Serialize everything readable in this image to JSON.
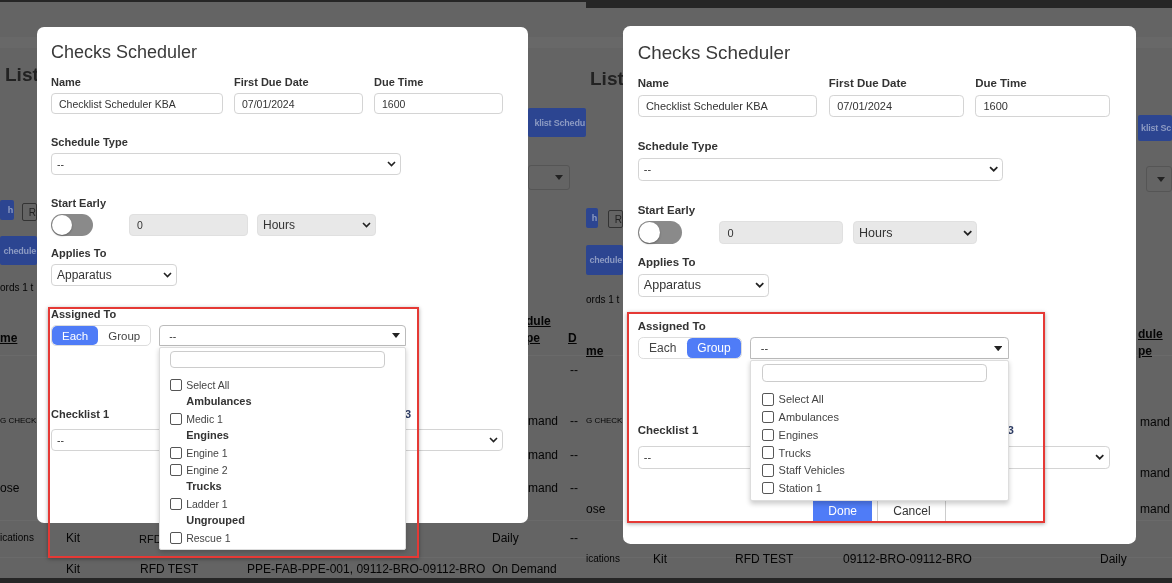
{
  "panels": [
    {
      "backdrop": [
        {
          "kind": "title",
          "text": "List"
        },
        {
          "kind": "button",
          "text": "klist Schedu"
        },
        {
          "kind": "select"
        },
        {
          "kind": "button",
          "text": "h"
        },
        {
          "kind": "outline_button",
          "text": "R"
        },
        {
          "kind": "tab",
          "text": "chedule"
        },
        {
          "kind": "info",
          "text": "ords 1 t"
        },
        {
          "kind": "header",
          "text": "me"
        },
        {
          "kind": "header",
          "text": "dule pe"
        },
        {
          "kind": "header",
          "text": "D"
        },
        {
          "kind": "cell",
          "text": "--"
        },
        {
          "kind": "cell",
          "text": "G CHECK"
        },
        {
          "kind": "cell",
          "text": "mand"
        },
        {
          "kind": "cell",
          "text": "--"
        },
        {
          "kind": "cell",
          "text": "mand"
        },
        {
          "kind": "cell",
          "text": "--"
        },
        {
          "kind": "cell",
          "text": "ose"
        },
        {
          "kind": "cell",
          "text": "mand"
        },
        {
          "kind": "cell",
          "text": "--"
        },
        {
          "kind": "cell",
          "text": "ications"
        },
        {
          "kind": "cell",
          "text": "Kit"
        },
        {
          "kind": "cell",
          "text": "RFD"
        },
        {
          "kind": "cell",
          "text": "Daily"
        },
        {
          "kind": "cell",
          "text": "--"
        },
        {
          "kind": "cell",
          "text": "Kit"
        },
        {
          "kind": "cell",
          "text": "RFD TEST"
        },
        {
          "kind": "cell",
          "text": "PPE-FAB-PPE-001, 09112-BRO-09112-BRO"
        },
        {
          "kind": "cell",
          "text": "On Demand"
        }
      ],
      "highlight_frame": true,
      "dialog": {
        "title": "Checks Scheduler",
        "top_fields": [
          {
            "label": "Name",
            "value": "Checklist Scheduler KBA"
          },
          {
            "label": "First Due Date",
            "value": "07/01/2024"
          },
          {
            "label": "Due Time",
            "value": "1600"
          }
        ],
        "schedule_type": {
          "label": "Schedule Type",
          "value": "--"
        },
        "start_early": {
          "label": "Start Early",
          "on": false,
          "disabled": true,
          "amount": "0",
          "unit": "Hours"
        },
        "applies_to": {
          "label": "Applies To",
          "value": "Apparatus"
        },
        "assigned_to": {
          "label": "Assigned To",
          "modes": [
            {
              "label": "Each",
              "selected": true
            },
            {
              "label": "Group",
              "selected": false
            }
          ],
          "value": "--",
          "expanded": true,
          "options": [
            {
              "kind": "option",
              "label": "Select All",
              "checked": false
            },
            {
              "kind": "group",
              "label": "Ambulances"
            },
            {
              "kind": "option",
              "label": "Medic 1",
              "checked": false
            },
            {
              "kind": "group",
              "label": "Engines"
            },
            {
              "kind": "option",
              "label": "Engine 1",
              "checked": false
            },
            {
              "kind": "option",
              "label": "Engine 2",
              "checked": false
            },
            {
              "kind": "group",
              "label": "Trucks"
            },
            {
              "kind": "option",
              "label": "Ladder 1",
              "checked": false
            },
            {
              "kind": "group",
              "label": "Ungrouped"
            },
            {
              "kind": "option",
              "label": "Rescue 1",
              "checked": false
            }
          ]
        },
        "checklist": {
          "label": "Checklist 1",
          "label_2": "3",
          "value": "--"
        }
      }
    },
    {
      "backdrop": [
        {
          "kind": "title",
          "text": "List"
        },
        {
          "kind": "button",
          "text": "klist Sc"
        },
        {
          "kind": "select"
        },
        {
          "kind": "button",
          "text": "h"
        },
        {
          "kind": "outline_button",
          "text": "R"
        },
        {
          "kind": "tab",
          "text": "chedule"
        },
        {
          "kind": "info",
          "text": "ords 1 t"
        },
        {
          "kind": "header",
          "text": "me"
        },
        {
          "kind": "header",
          "text": "dule pe"
        },
        {
          "kind": "cell",
          "text": "G CHECK"
        },
        {
          "kind": "cell",
          "text": "mand"
        },
        {
          "kind": "cell",
          "text": "mand"
        },
        {
          "kind": "cell",
          "text": "ose"
        },
        {
          "kind": "cell",
          "text": "mand"
        },
        {
          "kind": "cell",
          "text": "ications"
        },
        {
          "kind": "cell",
          "text": "Kit"
        },
        {
          "kind": "cell",
          "text": "RFD TEST"
        },
        {
          "kind": "cell",
          "text": "09112-BRO-09112-BRO"
        },
        {
          "kind": "cell",
          "text": "Daily"
        }
      ],
      "highlight_frame": true,
      "dialog": {
        "title": "Checks Scheduler",
        "top_fields": [
          {
            "label": "Name",
            "value": "Checklist Scheduler KBA"
          },
          {
            "label": "First Due Date",
            "value": "07/01/2024"
          },
          {
            "label": "Due Time",
            "value": "1600"
          }
        ],
        "schedule_type": {
          "label": "Schedule Type",
          "value": "--"
        },
        "start_early": {
          "label": "Start Early",
          "on": false,
          "disabled": true,
          "amount": "0",
          "unit": "Hours"
        },
        "applies_to": {
          "label": "Applies To",
          "value": "Apparatus"
        },
        "assigned_to": {
          "label": "Assigned To",
          "modes": [
            {
              "label": "Each",
              "selected": false
            },
            {
              "label": "Group",
              "selected": true
            }
          ],
          "value": "--",
          "expanded": true,
          "options": [
            {
              "kind": "option",
              "label": "Select All",
              "checked": false
            },
            {
              "kind": "option",
              "label": "Ambulances",
              "checked": false
            },
            {
              "kind": "option",
              "label": "Engines",
              "checked": false
            },
            {
              "kind": "option",
              "label": "Trucks",
              "checked": false
            },
            {
              "kind": "option",
              "label": "Staff Vehicles",
              "checked": false
            },
            {
              "kind": "option",
              "label": "Station 1",
              "checked": false
            }
          ]
        },
        "checklist": {
          "label": "Checklist 1",
          "label_2": "3",
          "value": "--"
        },
        "buttons": [
          {
            "kind": "primary",
            "label": "Done"
          },
          {
            "kind": "secondary",
            "label": "Cancel"
          }
        ]
      }
    }
  ]
}
